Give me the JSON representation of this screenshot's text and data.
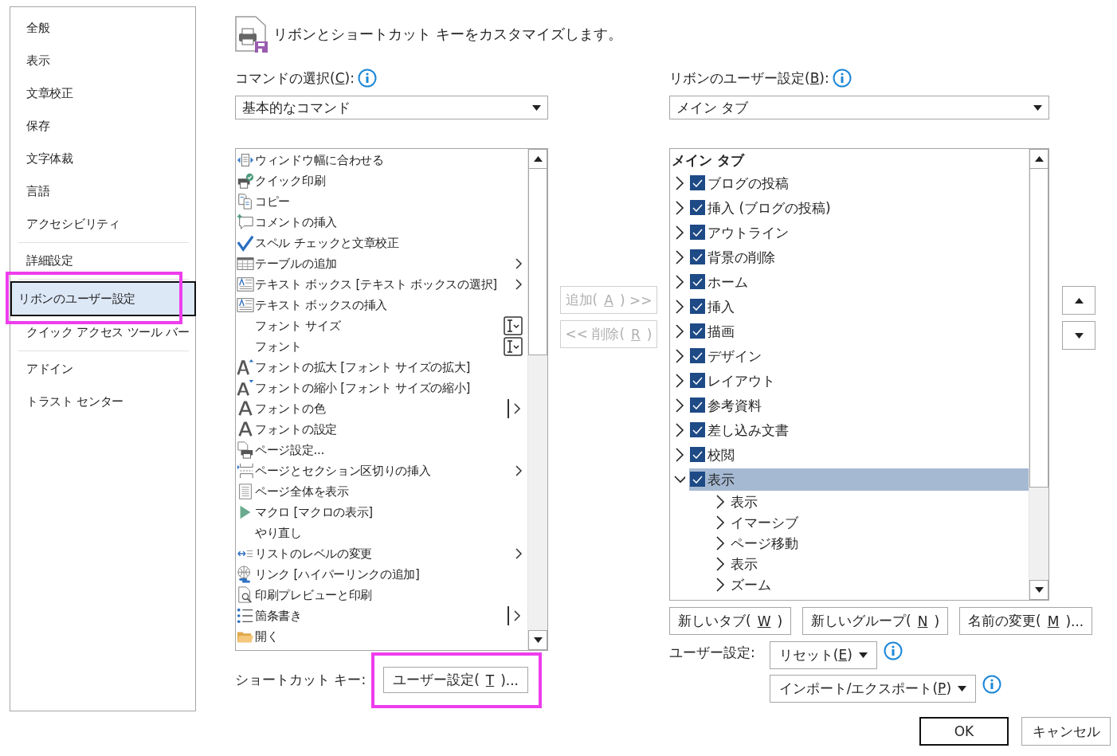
{
  "sidebar": {
    "groups": [
      [
        {
          "label": "全般",
          "selected": false,
          "highlighted": false
        },
        {
          "label": "表示",
          "selected": false,
          "highlighted": false
        },
        {
          "label": "文章校正",
          "selected": false,
          "highlighted": false
        },
        {
          "label": "保存",
          "selected": false,
          "highlighted": false
        },
        {
          "label": "文字体裁",
          "selected": false,
          "highlighted": false
        },
        {
          "label": "言語",
          "selected": false,
          "highlighted": false
        },
        {
          "label": "アクセシビリティ",
          "selected": false,
          "highlighted": false
        }
      ],
      [
        {
          "label": "詳細設定",
          "selected": false,
          "highlighted": false
        }
      ],
      [
        {
          "label": "リボンのユーザー設定",
          "selected": true,
          "highlighted": true
        },
        {
          "label": "クイック アクセス ツール バー",
          "selected": false,
          "highlighted": false
        }
      ],
      [
        {
          "label": "アドイン",
          "selected": false,
          "highlighted": false
        },
        {
          "label": "トラスト センター",
          "selected": false,
          "highlighted": false
        }
      ]
    ]
  },
  "header": {
    "title": "リボンとショートカット キーをカスタマイズします。"
  },
  "commands": {
    "label": {
      "before": "コマンドの選択(",
      "key": "C",
      "after": "):"
    },
    "dropdown": "基本的なコマンド",
    "items": [
      {
        "label": "ウィンドウ幅に合わせる",
        "kind": "fit"
      },
      {
        "label": "クイック印刷",
        "kind": "print"
      },
      {
        "label": "コピー",
        "kind": "copy"
      },
      {
        "label": "コメントの挿入",
        "kind": "comment"
      },
      {
        "label": "スペル チェックと文章校正",
        "kind": "spell"
      },
      {
        "label": "テーブルの追加",
        "kind": "table",
        "submenu": true
      },
      {
        "label": "テキスト ボックス [テキスト ボックスの選択]",
        "kind": "textbox",
        "submenu": true
      },
      {
        "label": "テキスト ボックスの挿入",
        "kind": "textbox"
      },
      {
        "label": "フォント サイズ",
        "kind": "none",
        "combo": true
      },
      {
        "label": "フォント",
        "kind": "none",
        "combo": true
      },
      {
        "label": "フォントの拡大 [フォント サイズの拡大]",
        "kind": "grow"
      },
      {
        "label": "フォントの縮小 [フォント サイズの縮小]",
        "kind": "shrink"
      },
      {
        "label": "フォントの色",
        "kind": "letter",
        "split": true
      },
      {
        "label": "フォントの設定",
        "kind": "letter"
      },
      {
        "label": "ページ設定...",
        "kind": "pagesetup"
      },
      {
        "label": "ページとセクション区切りの挿入",
        "kind": "break",
        "submenu": true
      },
      {
        "label": "ページ全体を表示",
        "kind": "page"
      },
      {
        "label": "マクロ [マクロの表示]",
        "kind": "macro"
      },
      {
        "label": "やり直し",
        "kind": "none"
      },
      {
        "label": "リストのレベルの変更",
        "kind": "level",
        "submenu": true
      },
      {
        "label": "リンク [ハイパーリンクの追加]",
        "kind": "link"
      },
      {
        "label": "印刷プレビューと印刷",
        "kind": "preview"
      },
      {
        "label": "箇条書き",
        "kind": "bullets",
        "split": true
      },
      {
        "label": "開く",
        "kind": "folder"
      }
    ]
  },
  "shortcut": {
    "label": "ショートカット キー:",
    "button": {
      "before": "ユーザー設定(",
      "key": "T",
      "after": ")..."
    },
    "highlighted": true
  },
  "transfer": [
    {
      "label": {
        "before": "追加(",
        "key": "A",
        "after": ") >>"
      },
      "disabled": true
    },
    {
      "label": {
        "before": "<< 削除(",
        "key": "R",
        "after": ")"
      },
      "disabled": true
    }
  ],
  "ribbon": {
    "label": {
      "before": "リボンのユーザー設定(",
      "key": "B",
      "after": "):"
    },
    "dropdown": "メイン タブ",
    "tree_header": "メイン タブ",
    "items": [
      {
        "label": "ブログの投稿",
        "checked": true,
        "expanded": false,
        "selected": false
      },
      {
        "label": "挿入 (ブログの投稿)",
        "checked": true,
        "expanded": false,
        "selected": false
      },
      {
        "label": "アウトライン",
        "checked": true,
        "expanded": false,
        "selected": false
      },
      {
        "label": "背景の削除",
        "checked": true,
        "expanded": false,
        "selected": false
      },
      {
        "label": "ホーム",
        "checked": true,
        "expanded": false,
        "selected": false
      },
      {
        "label": "挿入",
        "checked": true,
        "expanded": false,
        "selected": false
      },
      {
        "label": "描画",
        "checked": true,
        "expanded": false,
        "selected": false
      },
      {
        "label": "デザイン",
        "checked": true,
        "expanded": false,
        "selected": false
      },
      {
        "label": "レイアウト",
        "checked": true,
        "expanded": false,
        "selected": false
      },
      {
        "label": "参考資料",
        "checked": true,
        "expanded": false,
        "selected": false
      },
      {
        "label": "差し込み文書",
        "checked": true,
        "expanded": false,
        "selected": false
      },
      {
        "label": "校閲",
        "checked": true,
        "expanded": false,
        "selected": false
      },
      {
        "label": "表示",
        "checked": true,
        "expanded": true,
        "selected": true,
        "children": [
          {
            "label": "表示"
          },
          {
            "label": "イマーシブ"
          },
          {
            "label": "ページ移動"
          },
          {
            "label": "表示"
          },
          {
            "label": "ズーム"
          }
        ]
      }
    ],
    "buttons": [
      {
        "before": "新しいタブ(",
        "key": "W",
        "after": ")"
      },
      {
        "before": "新しいグループ(",
        "key": "N",
        "after": ")"
      },
      {
        "before": "名前の変更(",
        "key": "M",
        "after": ")..."
      }
    ],
    "customize_label": "ユーザー設定:",
    "menus": [
      {
        "before": "リセット(",
        "key": "E",
        "after": ")"
      },
      {
        "before": "インポート/エクスポート(",
        "key": "P",
        "after": ")"
      }
    ]
  },
  "footer": {
    "ok": "OK",
    "cancel": "キャンセル"
  }
}
